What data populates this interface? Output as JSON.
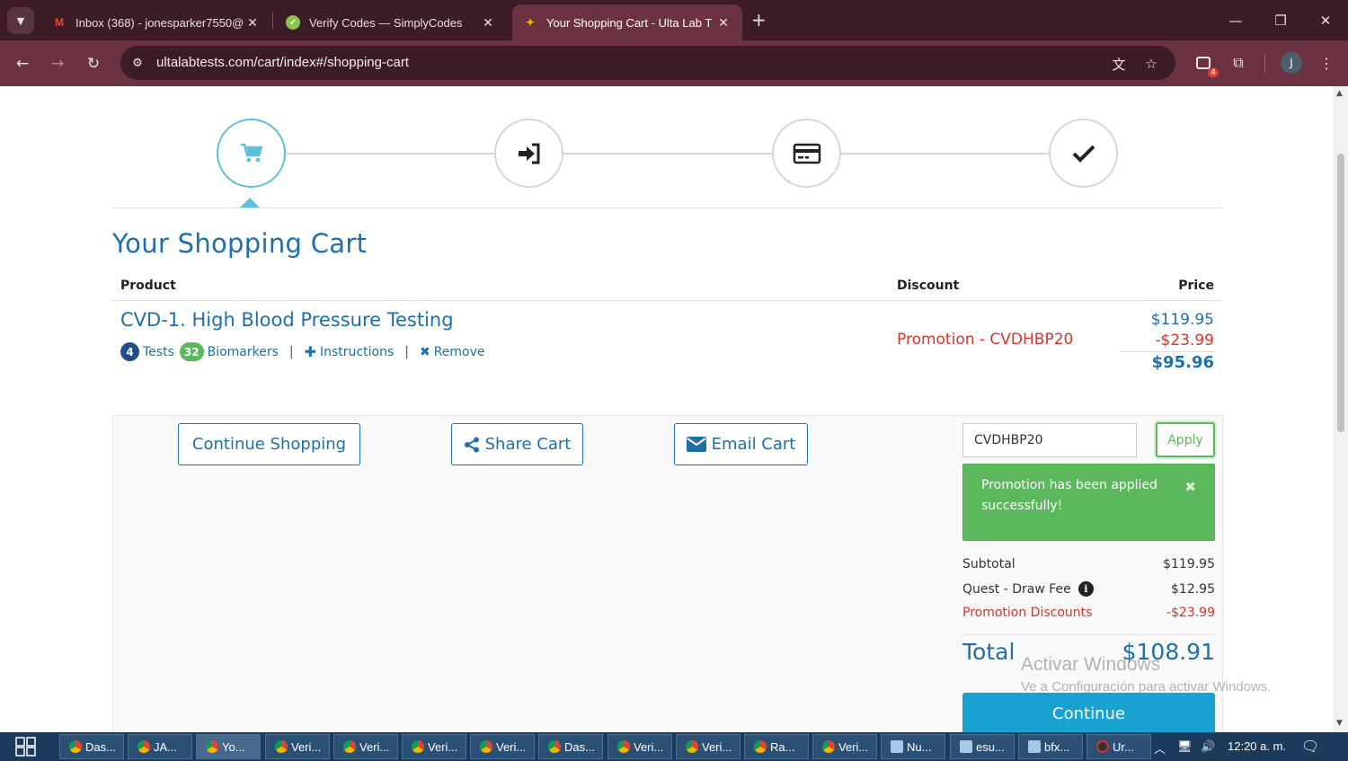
{
  "browser": {
    "tabs": [
      {
        "title": "Inbox (368) - jonesparker7550@",
        "icon": "gmail-icon",
        "active": false
      },
      {
        "title": "Verify Codes — SimplyCodes",
        "icon": "simplycodes-icon",
        "active": false
      },
      {
        "title": "Your Shopping Cart - Ulta Lab T",
        "icon": "ulta-lab-icon",
        "active": true
      }
    ],
    "url": "ultalabtests.com/cart/index#/shopping-cart",
    "profile_initial": "J",
    "extension_badge": "4"
  },
  "steps": [
    {
      "name": "cart-icon",
      "active": true
    },
    {
      "name": "sign-in-icon",
      "active": false
    },
    {
      "name": "credit-card-icon",
      "active": false
    },
    {
      "name": "checkmark-icon",
      "active": false
    }
  ],
  "cart": {
    "title": "Your Shopping Cart",
    "headers": {
      "product": "Product",
      "discount": "Discount",
      "price": "Price"
    },
    "item": {
      "name": "CVD-1. High Blood Pressure Testing",
      "tests_count": "4",
      "tests_label": "Tests",
      "biomarkers_count": "32",
      "biomarkers_label": "Biomarkers",
      "instructions_label": "Instructions",
      "remove_label": "Remove",
      "discount_label": "Promotion - CVDHBP20",
      "price_original": "$119.95",
      "price_discount": "-$23.99",
      "price_final": "$95.96"
    }
  },
  "actions": {
    "continue_shopping": "Continue Shopping",
    "share_cart": "Share Cart",
    "email_cart": "Email Cart"
  },
  "promo": {
    "code_value": "CVDHBP20",
    "apply_label": "Apply",
    "success_message": "Promotion has been applied successfully!",
    "close_glyph": "✖"
  },
  "summary": {
    "subtotal_label": "Subtotal",
    "subtotal_value": "$119.95",
    "draw_fee_label": "Quest - Draw Fee",
    "draw_fee_value": "$12.95",
    "promo_label": "Promotion Discounts",
    "promo_value": "-$23.99",
    "total_label": "Total",
    "total_value": "$108.91",
    "continue_label": "Continue"
  },
  "watermark": {
    "line1": "Activar Windows",
    "line2": "Ve a Configuración para activar Windows."
  },
  "taskbar": {
    "items": [
      {
        "label": "Das...",
        "icon": "chrome"
      },
      {
        "label": "JA...",
        "icon": "chrome"
      },
      {
        "label": "Yo...",
        "icon": "chrome",
        "active": true
      },
      {
        "label": "Veri...",
        "icon": "chrome"
      },
      {
        "label": "Veri...",
        "icon": "chrome"
      },
      {
        "label": "Veri...",
        "icon": "chrome"
      },
      {
        "label": "Veri...",
        "icon": "chrome"
      },
      {
        "label": "Das...",
        "icon": "chrome"
      },
      {
        "label": "Veri...",
        "icon": "chrome"
      },
      {
        "label": "Veri...",
        "icon": "chrome"
      },
      {
        "label": "Ra...",
        "icon": "chrome"
      },
      {
        "label": "Veri...",
        "icon": "chrome"
      },
      {
        "label": "Nu...",
        "icon": "notepad"
      },
      {
        "label": "esu...",
        "icon": "notepad"
      },
      {
        "label": "bfx...",
        "icon": "notepad"
      },
      {
        "label": "Ur...",
        "icon": "obs"
      }
    ],
    "clock": "12:20 a. m."
  },
  "colors": {
    "brand_blue": "#1f6fa8",
    "accent_cyan": "#5bc0de",
    "success_green": "#5cb85c",
    "danger_red": "#d9342b",
    "continue_blue": "#17a2d1",
    "chrome_frame": "#3c1c26"
  }
}
